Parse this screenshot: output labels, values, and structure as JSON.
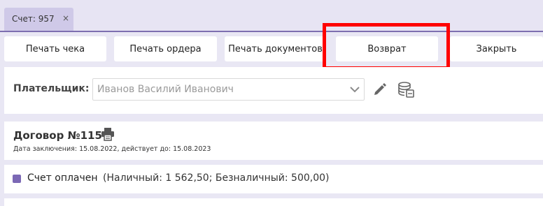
{
  "tab": {
    "label": "Счет: 957",
    "close": "×"
  },
  "toolbar": {
    "print_check": "Печать чека",
    "print_order": "Печать ордера",
    "print_docs": "Печать документов",
    "return": "Возврат",
    "close": "Закрыть"
  },
  "payer": {
    "label": "Плательщик:",
    "value": "Иванов Василий Иванович"
  },
  "contract": {
    "title": "Договор №115",
    "subtitle": "Дата заключения: 15.08.2022, действует до: 15.08.2023"
  },
  "payment": {
    "status_label": "Счет оплачен",
    "details": "(Наличный: 1 562,50; Безналичный: 500,00)",
    "paid": true
  },
  "colors": {
    "accent": "#7b68b5",
    "tab_bg": "#cfc9e8",
    "page_bg": "#e9e7f4",
    "highlight": "#ff0000"
  },
  "icons": [
    "close-icon",
    "chevron-down-icon",
    "pencil-icon",
    "database-icon",
    "printer-icon",
    "checkbox-icon"
  ]
}
